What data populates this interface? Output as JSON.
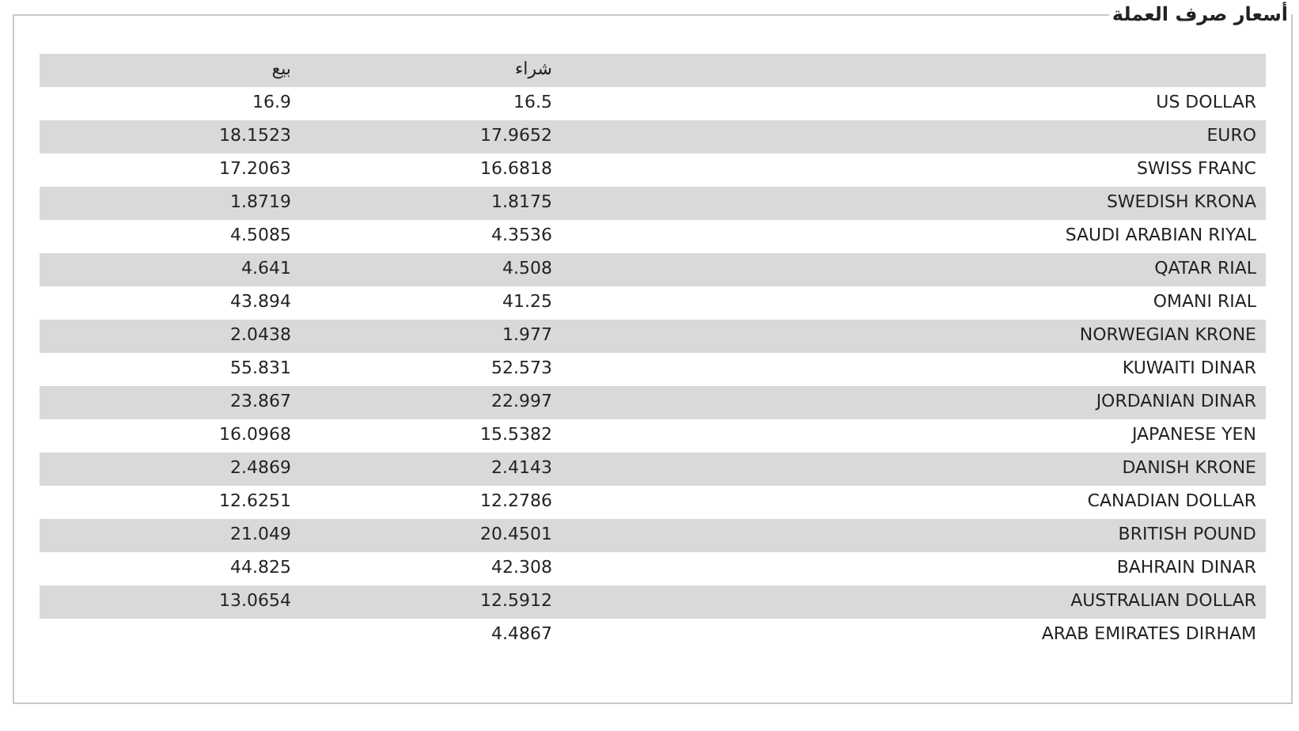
{
  "panel": {
    "title": "أسعار صرف العملة"
  },
  "table": {
    "columns": [
      "شراء",
      "بيع"
    ],
    "rows": [
      {
        "currency": "US DOLLAR",
        "buy": "16.5",
        "sell": "16.9"
      },
      {
        "currency": "EURO",
        "buy": "17.9652",
        "sell": "18.1523"
      },
      {
        "currency": "SWISS FRANC",
        "buy": "16.6818",
        "sell": "17.2063"
      },
      {
        "currency": "SWEDISH KRONA",
        "buy": "1.8175",
        "sell": "1.8719"
      },
      {
        "currency": "SAUDI ARABIAN RIYAL",
        "buy": "4.3536",
        "sell": "4.5085"
      },
      {
        "currency": "QATAR RIAL",
        "buy": "4.508",
        "sell": "4.641"
      },
      {
        "currency": "OMANI RIAL",
        "buy": "41.25",
        "sell": "43.894"
      },
      {
        "currency": "NORWEGIAN KRONE",
        "buy": "1.977",
        "sell": "2.0438"
      },
      {
        "currency": "KUWAITI DINAR",
        "buy": "52.573",
        "sell": "55.831"
      },
      {
        "currency": "JORDANIAN DINAR",
        "buy": "22.997",
        "sell": "23.867"
      },
      {
        "currency": "JAPANESE YEN",
        "buy": "15.5382",
        "sell": "16.0968"
      },
      {
        "currency": "DANISH KRONE",
        "buy": "2.4143",
        "sell": "2.4869"
      },
      {
        "currency": "CANADIAN DOLLAR",
        "buy": "12.2786",
        "sell": "12.6251"
      },
      {
        "currency": "BRITISH POUND",
        "buy": "20.4501",
        "sell": "21.049"
      },
      {
        "currency": "BAHRAIN DINAR",
        "buy": "42.308",
        "sell": "44.825"
      },
      {
        "currency": "AUSTRALIAN DOLLAR",
        "buy": "12.5912",
        "sell": "13.0654"
      },
      {
        "currency": "ARAB EMIRATES DIRHAM",
        "buy": "4.4867"
      }
    ]
  }
}
